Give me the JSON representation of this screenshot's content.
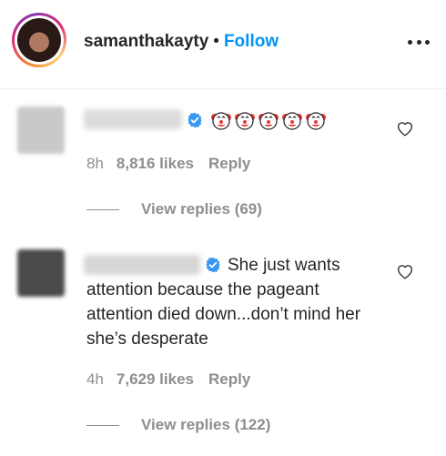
{
  "header": {
    "username": "samanthakayty",
    "separator": "•",
    "follow_label": "Follow"
  },
  "comments": [
    {
      "text": "",
      "emoji": [
        "🤡",
        "🤡",
        "🤡",
        "🤡",
        "🤡"
      ],
      "time": "8h",
      "likes": "8,816 likes",
      "reply_label": "Reply",
      "view_replies": "View replies (69)"
    },
    {
      "text": "She just wants attention because the pageant attention died down...don’t mind her she’s desperate",
      "time": "4h",
      "likes": "7,629 likes",
      "reply_label": "Reply",
      "view_replies": "View replies (122)"
    }
  ],
  "colors": {
    "link": "#0095f6",
    "muted": "#8e8e8e",
    "verified": "#3897f0",
    "text": "#262626"
  },
  "icons": [
    "avatar",
    "more-options-icon",
    "verified-badge-icon",
    "clown-face-icon",
    "heart-icon"
  ]
}
